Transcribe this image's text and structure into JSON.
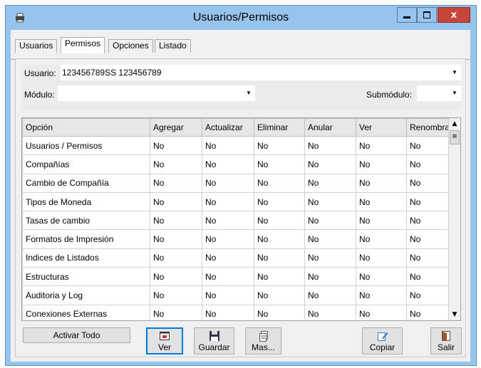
{
  "window": {
    "title": "Usuarios/Permisos",
    "close_glyph": "x"
  },
  "tabs": [
    "Usuarios",
    "Permisos",
    "Opciones",
    "Listado"
  ],
  "form": {
    "usuario_label": "Usuario:",
    "usuario_value": "123456789SS  123456789",
    "modulo_label": "Módulo:",
    "modulo_value": "",
    "submodulo_label": "Submódulo:",
    "submodulo_value": ""
  },
  "grid": {
    "columns": [
      "Opción",
      "Agregar",
      "Actualizar",
      "Eliminar",
      "Anular",
      "Ver",
      "Renombrar"
    ],
    "rows": [
      [
        "Usuarios / Permisos",
        "No",
        "No",
        "No",
        "No",
        "No",
        "No"
      ],
      [
        "Compañías",
        "No",
        "No",
        "No",
        "No",
        "No",
        "No"
      ],
      [
        "Cambio de Compañía",
        "No",
        "No",
        "No",
        "No",
        "No",
        "No"
      ],
      [
        "Tipos de Moneda",
        "No",
        "No",
        "No",
        "No",
        "No",
        "No"
      ],
      [
        "Tasas de cambio",
        "No",
        "No",
        "No",
        "No",
        "No",
        "No"
      ],
      [
        "Formatos de Impresión",
        "No",
        "No",
        "No",
        "No",
        "No",
        "No"
      ],
      [
        "Indices de Listados",
        "No",
        "No",
        "No",
        "No",
        "No",
        "No"
      ],
      [
        "Estructuras",
        "No",
        "No",
        "No",
        "No",
        "No",
        "No"
      ],
      [
        "Auditoria y Log",
        "No",
        "No",
        "No",
        "No",
        "No",
        "No"
      ],
      [
        "Conexiones Externas",
        "No",
        "No",
        "No",
        "No",
        "No",
        "No"
      ]
    ]
  },
  "buttons": {
    "activar_todo": "Activar Todo",
    "ver": "Ver",
    "guardar": "Guardar",
    "mas": "Mas...",
    "copiar": "Copiar",
    "salir": "Salir"
  },
  "icons": {
    "app": "printer-icon",
    "ver": "view-icon",
    "guardar": "floppy-disk-icon",
    "mas": "document-list-icon",
    "copiar": "copy-edit-icon",
    "salir": "exit-door-icon"
  },
  "colors": {
    "title_bar": "#97c4ec",
    "close_button": "#c7463a",
    "focus_border": "#0078d7"
  }
}
